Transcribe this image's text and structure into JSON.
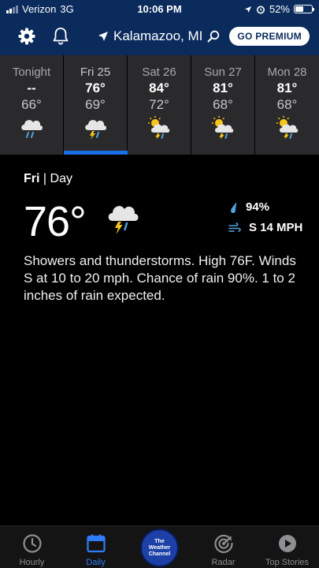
{
  "status_bar": {
    "carrier": "Verizon",
    "network": "3G",
    "time": "10:06 PM",
    "battery": "52%",
    "battery_level": 0.52
  },
  "header": {
    "location": "Kalamazoo, MI",
    "premium_label": "GO PREMIUM"
  },
  "days": [
    {
      "name": "Tonight",
      "hi": "--",
      "lo": "66°",
      "icon": "rain-icon"
    },
    {
      "name": "Fri 25",
      "hi": "76°",
      "lo": "69°",
      "icon": "thunderstorm-icon"
    },
    {
      "name": "Sat 26",
      "hi": "84°",
      "lo": "72°",
      "icon": "partly-cloudy-thunderstorm-icon"
    },
    {
      "name": "Sun 27",
      "hi": "81°",
      "lo": "68°",
      "icon": "partly-cloudy-thunderstorm-icon"
    },
    {
      "name": "Mon 28",
      "hi": "81°",
      "lo": "68°",
      "icon": "partly-cloudy-thunderstorm-icon"
    }
  ],
  "detail": {
    "day": "Fri",
    "period": "| Day",
    "temp": "76°",
    "precip": "94%",
    "wind": "S 14 MPH",
    "description": "Showers and thunderstorms. High 76F. Winds S at 10 to 20 mph. Chance of rain 90%. 1 to 2 inches of rain expected."
  },
  "tabbar": {
    "hourly": "Hourly",
    "daily": "Daily",
    "brand": [
      "The",
      "Weather",
      "Channel"
    ],
    "radar": "Radar",
    "top_stories": "Top Stories"
  },
  "colors": {
    "header_bg": "#0a2b5c",
    "accent": "#1a6fe6",
    "strip_bg": "#2a2a2c",
    "rain_blue": "#4fa3e0",
    "bolt_yellow": "#f5c518"
  }
}
